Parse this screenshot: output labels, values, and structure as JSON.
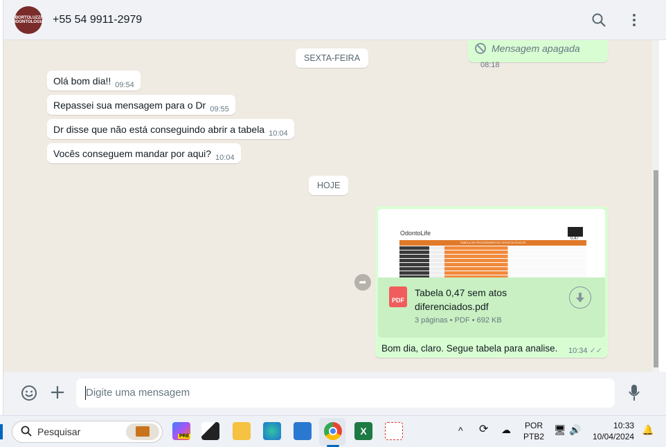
{
  "header": {
    "contact": "+55 54 9911-2979",
    "avatar_text": "BORTOLUZZI ODONTOLOGIA"
  },
  "chat": {
    "deleted": {
      "text": "Mensagem apagada",
      "time": "08:18"
    },
    "date1": "SEXTA-FEIRA",
    "incoming": [
      {
        "text": "Olá bom dia!!",
        "time": "09:54"
      },
      {
        "text": "Repassei sua mensagem para o Dr",
        "time": "09:55"
      },
      {
        "text": "Dr disse que não está conseguindo abrir a tabela",
        "time": "10:04"
      },
      {
        "text": "Vocês conseguem mandar por aqui?",
        "time": "10:04"
      }
    ],
    "date2": "HOJE",
    "document": {
      "preview_brand": "OdontoLife",
      "preview_title": "TABELA DE PROCEDIMENTOS ODONTOLÓGICOS",
      "preview_value": "0,47",
      "icon_label": "PDF",
      "name": "Tabela 0,47 sem atos diferenciados.pdf",
      "meta": "3 páginas • PDF • 692 KB",
      "caption": "Bom dia, claro. Segue tabela para analise.",
      "time": "10:34"
    }
  },
  "footer": {
    "placeholder": "Digite uma mensagem"
  },
  "taskbar": {
    "search": "Pesquisar",
    "lang1": "POR",
    "lang2": "PTB2",
    "time": "10:33",
    "date": "10/04/2024",
    "copilot_badge": "PRE"
  }
}
